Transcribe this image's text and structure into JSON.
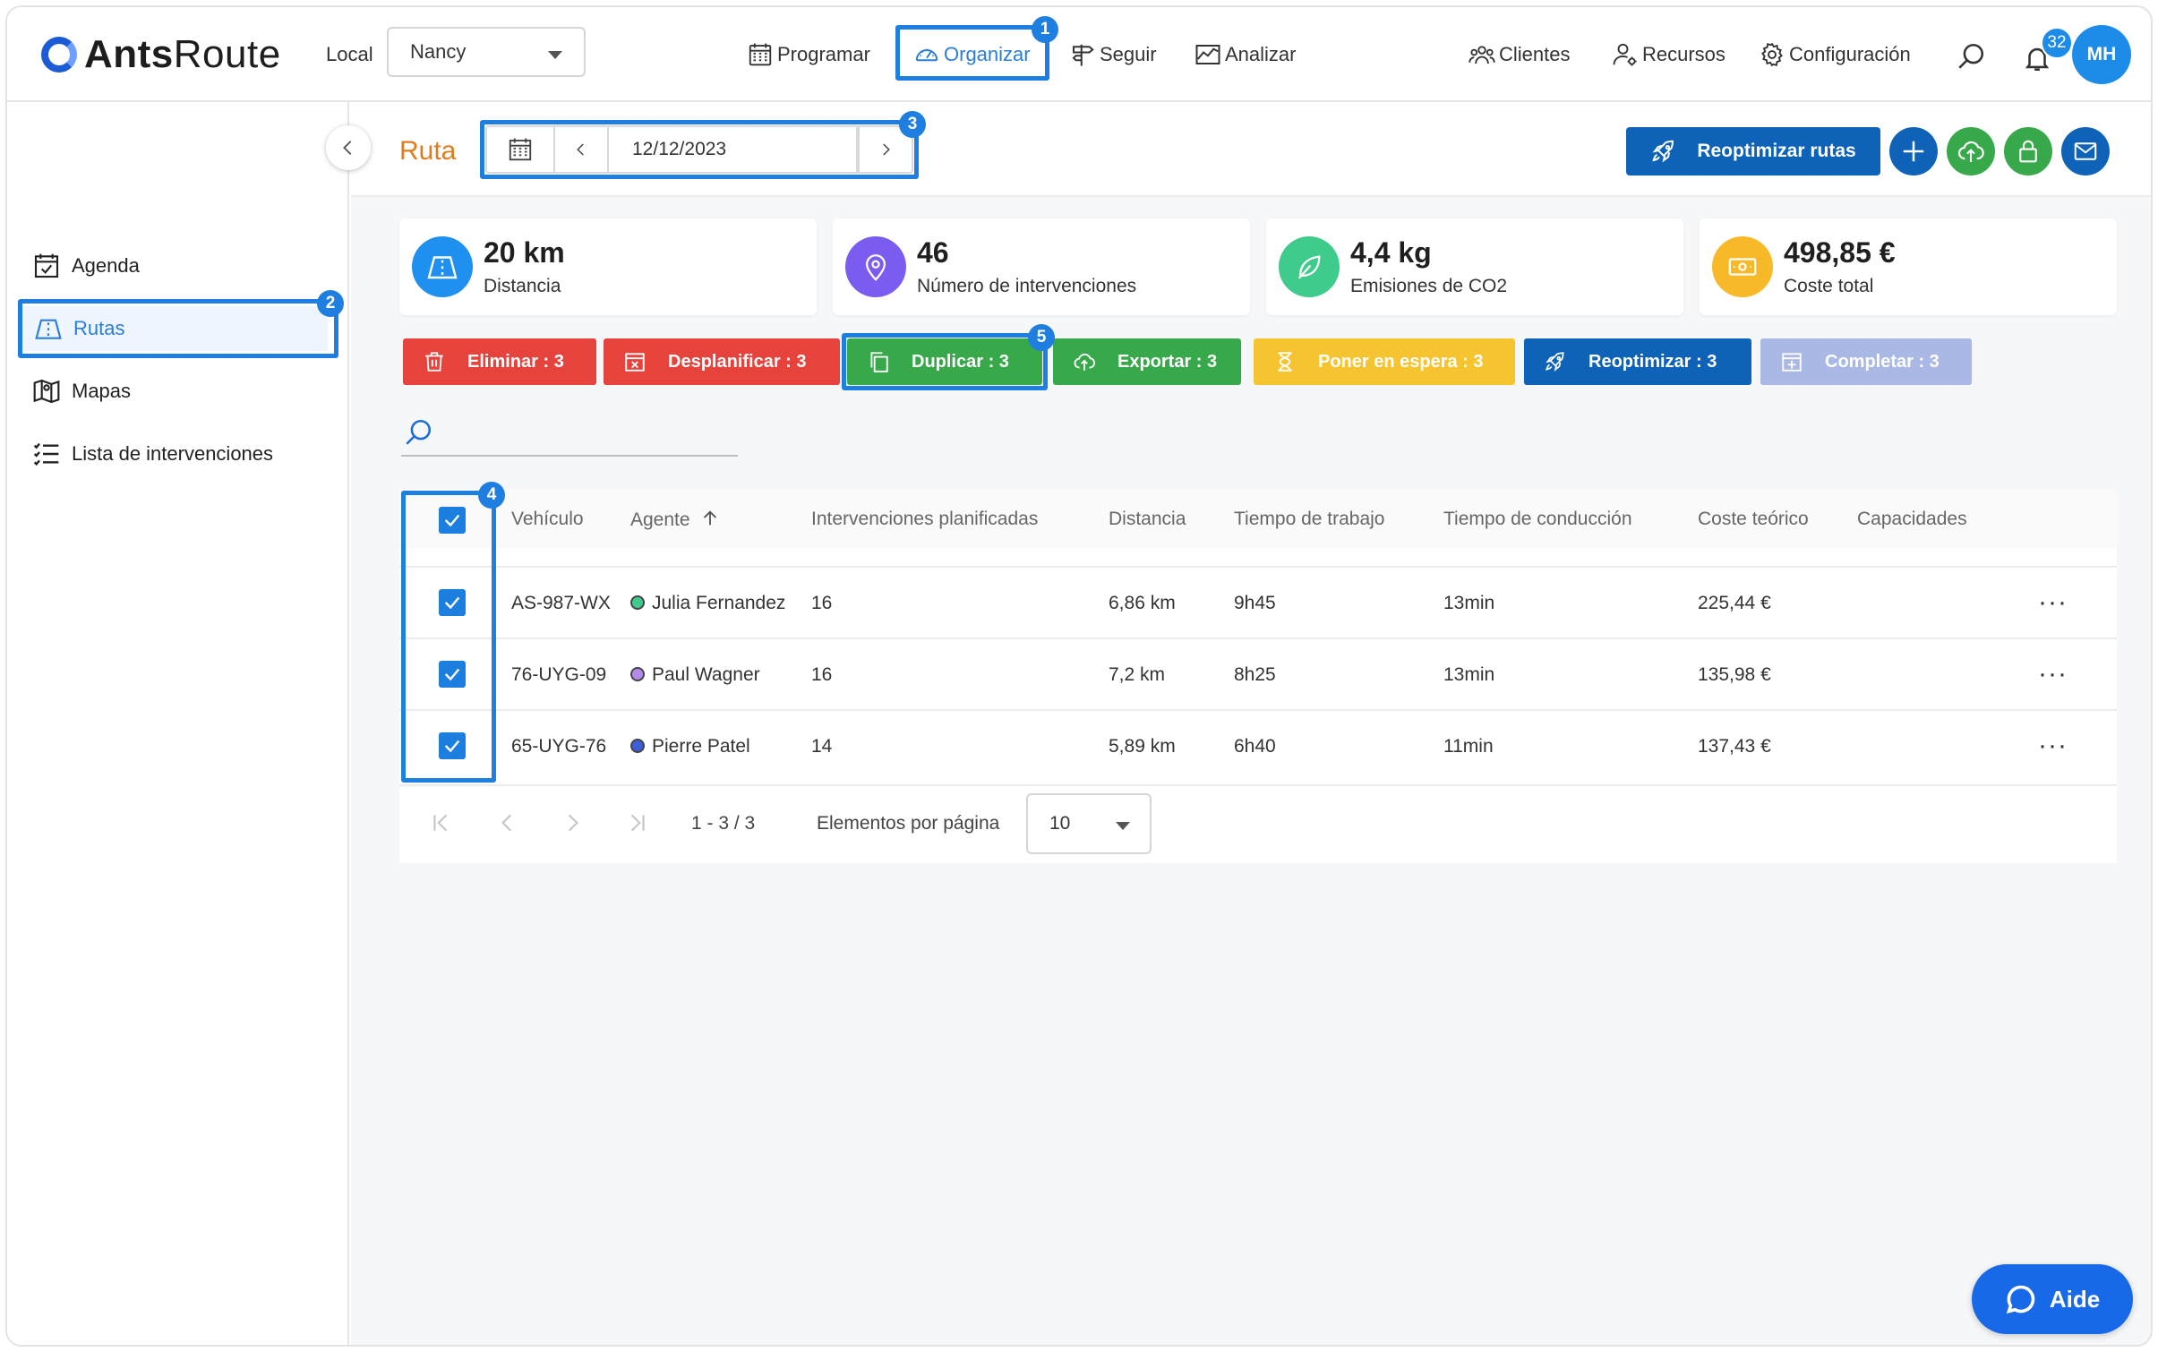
{
  "app": {
    "logo_bold": "Ants",
    "logo_rest": "Route"
  },
  "header": {
    "local_label": "Local",
    "local_value": "Nancy",
    "nav": [
      {
        "label": "Programar",
        "icon": "calendar-grid-icon"
      },
      {
        "label": "Organizar",
        "icon": "dashboard-gauge-icon",
        "active": true
      },
      {
        "label": "Seguir",
        "icon": "signpost-icon"
      },
      {
        "label": "Analizar",
        "icon": "chart-icon"
      }
    ],
    "right_nav": [
      {
        "label": "Clientes",
        "icon": "clients-icon"
      },
      {
        "label": "Recursos",
        "icon": "resources-icon"
      },
      {
        "label": "Configuración",
        "icon": "gear-icon"
      }
    ],
    "notifications_count": "32",
    "avatar_initials": "MH"
  },
  "annotations": [
    "1",
    "2",
    "3",
    "4",
    "5"
  ],
  "sidebar": {
    "items": [
      {
        "label": "Agenda",
        "icon": "agenda-icon"
      },
      {
        "label": "Rutas",
        "icon": "route-map-icon",
        "active": true
      },
      {
        "label": "Mapas",
        "icon": "map-pin-icon"
      },
      {
        "label": "Lista de intervenciones",
        "icon": "list-icon"
      }
    ]
  },
  "page": {
    "title": "Ruta",
    "date": "12/12/2023",
    "reoptimize_label": "Reoptimizar rutas"
  },
  "stats": [
    {
      "value": "20 km",
      "label": "Distancia",
      "color": "#1f8ff0"
    },
    {
      "value": "46",
      "label": "Número de intervenciones",
      "color": "#7a5cf0"
    },
    {
      "value": "4,4 kg",
      "label": "Emisiones de CO2",
      "color": "#3ecb8c"
    },
    {
      "value": "498,85 €",
      "label": "Coste total",
      "color": "#f7b928"
    }
  ],
  "actions": [
    {
      "label": "Eliminar : 3",
      "color": "#e5433c"
    },
    {
      "label": "Desplanificar : 3",
      "color": "#e5433c"
    },
    {
      "label": "Duplicar : 3",
      "color": "#38a94a"
    },
    {
      "label": "Exportar : 3",
      "color": "#38a94a"
    },
    {
      "label": "Poner en espera : 3",
      "color": "#f7c431"
    },
    {
      "label": "Reoptimizar : 3",
      "color": "#0e62b8"
    },
    {
      "label": "Completar : 3",
      "color": "#a9b8e4"
    }
  ],
  "table": {
    "columns": [
      "Vehículo",
      "Agente",
      "Intervenciones planificadas",
      "Distancia",
      "Tiempo de trabajo",
      "Tiempo de conducción",
      "Coste teórico",
      "Capacidades"
    ],
    "rows": [
      {
        "vehicle": "AS-987-WX",
        "agent": "Julia Fernandez",
        "agent_color": "#3ecb8c",
        "interventions": "16",
        "distance": "6,86 km",
        "work_time": "9h45",
        "drive_time": "13min",
        "cost": "225,44 €"
      },
      {
        "vehicle": "76-UYG-09",
        "agent": "Paul Wagner",
        "agent_color": "#b48be8",
        "interventions": "16",
        "distance": "7,2 km",
        "work_time": "8h25",
        "drive_time": "13min",
        "cost": "135,98 €"
      },
      {
        "vehicle": "65-UYG-76",
        "agent": "Pierre Patel",
        "agent_color": "#3d5ed9",
        "interventions": "14",
        "distance": "5,89 km",
        "work_time": "6h40",
        "drive_time": "11min",
        "cost": "137,43 €"
      }
    ],
    "more_label": "···"
  },
  "pagination": {
    "range": "1 - 3 / 3",
    "per_page_label": "Elementos por página",
    "per_page_value": "10"
  },
  "help": {
    "label": "Aide"
  }
}
